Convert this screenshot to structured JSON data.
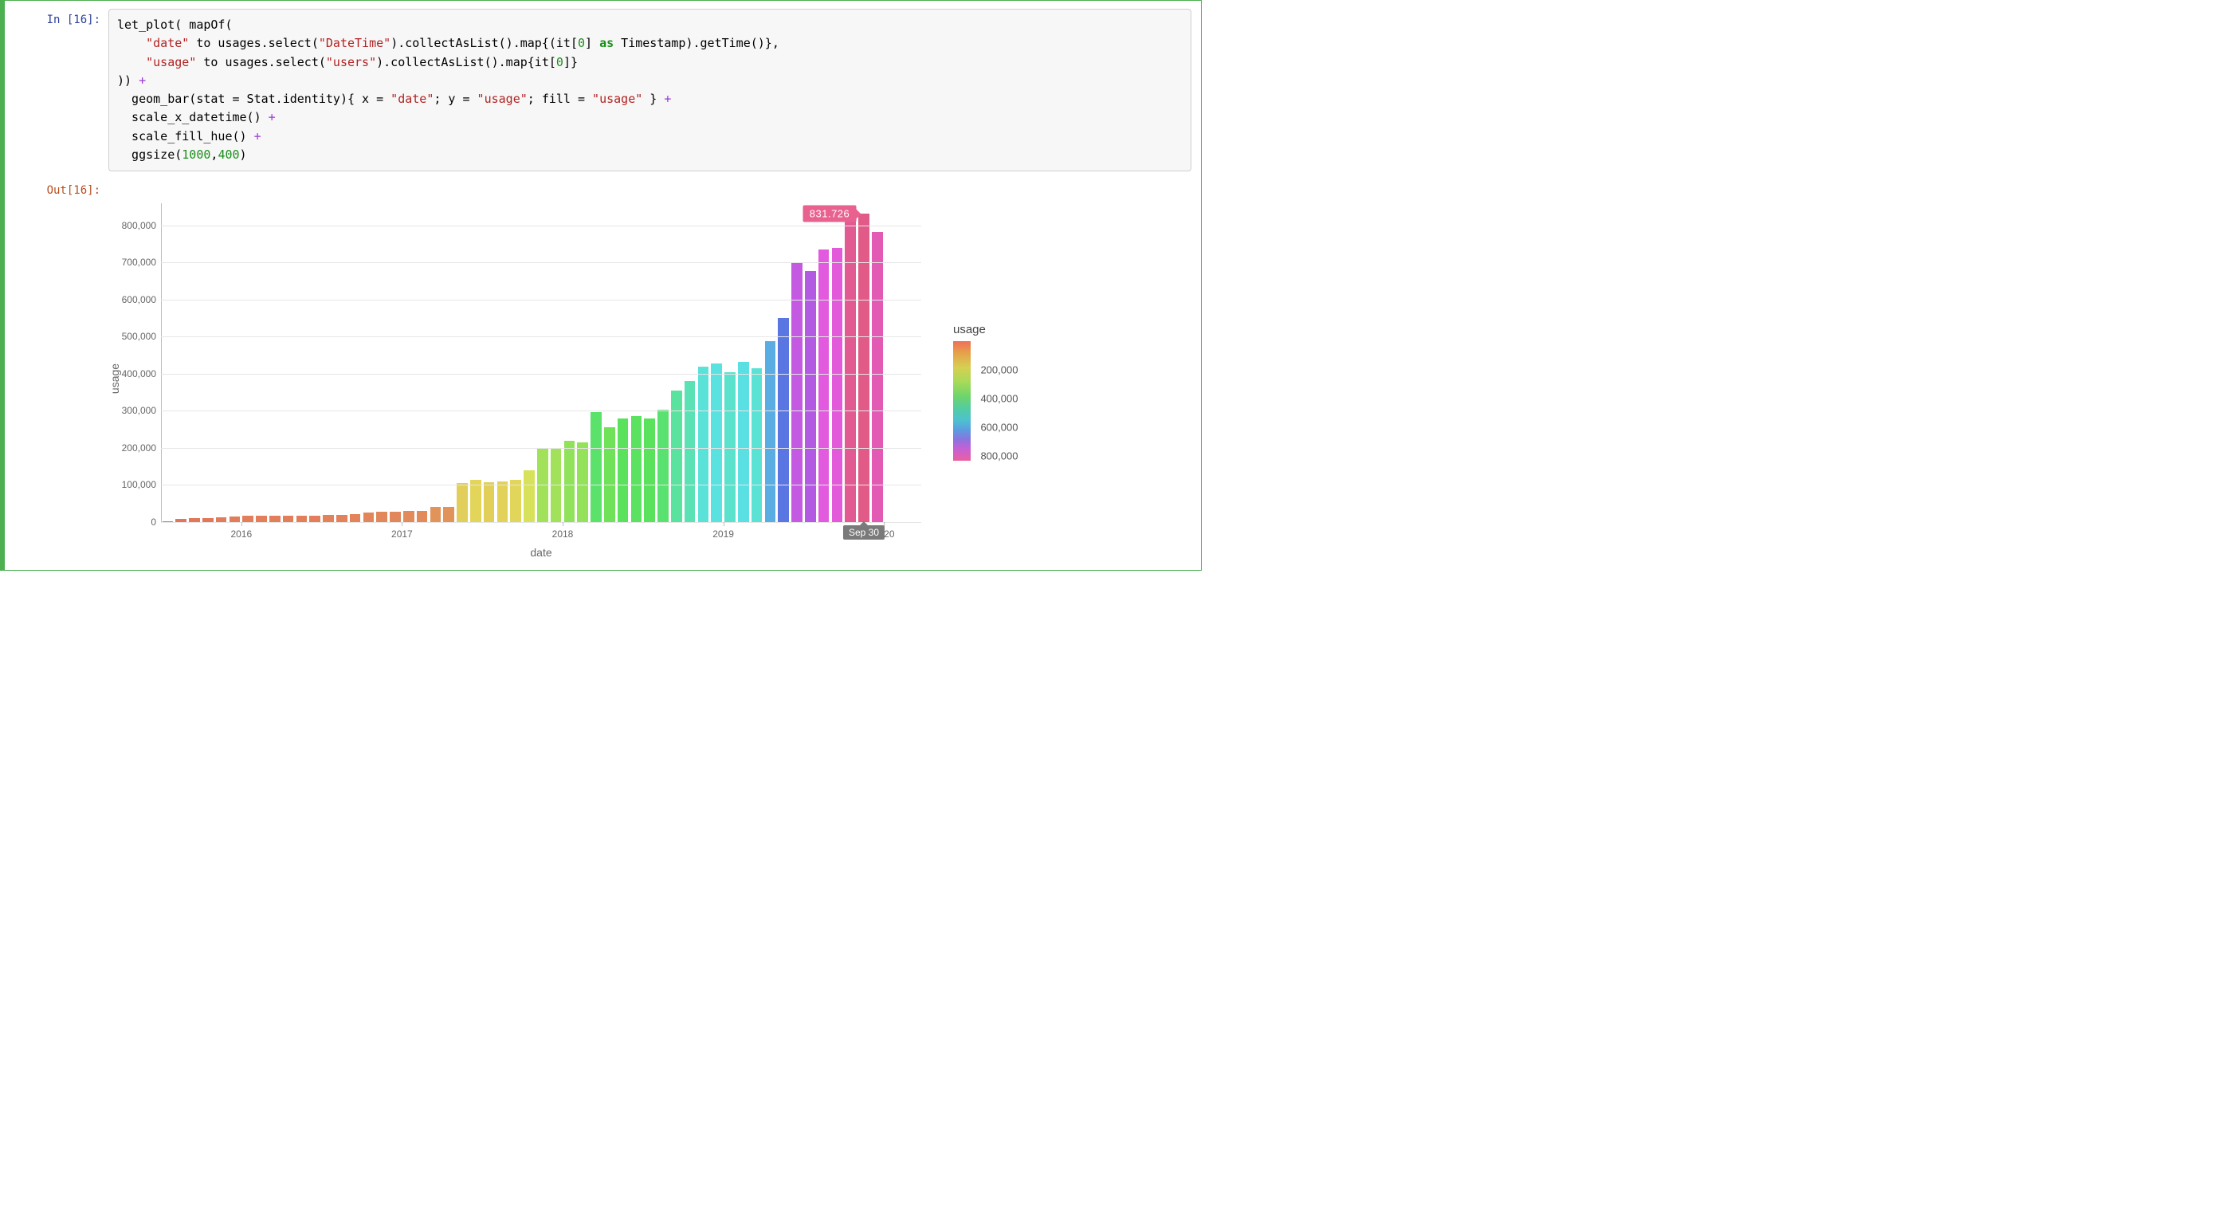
{
  "cell": {
    "in_label_prefix": "In [",
    "in_label_suffix": "]:",
    "out_label_prefix": "Out[",
    "out_label_suffix": "]:",
    "exec_count": "16"
  },
  "code": {
    "l1a": "let_plot( mapOf(",
    "l2a": "    ",
    "l2s1": "\"date\"",
    "l2b": " to usages.select(",
    "l2s2": "\"DateTime\"",
    "l2c": ").collectAsList().map{(it[",
    "l2n": "0",
    "l2d": "] ",
    "l2kw": "as",
    "l2e": " Timestamp).getTime()},",
    "l3a": "    ",
    "l3s1": "\"usage\"",
    "l3b": " to usages.select(",
    "l3s2": "\"users\"",
    "l3c": ").collectAsList().map{it[",
    "l3n": "0",
    "l3d": "]}",
    "l4a": ")) ",
    "l4op": "+",
    "l5a": "  geom_bar(stat = Stat.identity){ x = ",
    "l5s1": "\"date\"",
    "l5b": "; y = ",
    "l5s2": "\"usage\"",
    "l5c": "; fill = ",
    "l5s3": "\"usage\"",
    "l5d": " } ",
    "l5op": "+",
    "l6a": "  scale_x_datetime() ",
    "l6op": "+",
    "l7a": "  scale_fill_hue() ",
    "l7op": "+",
    "l8a": "  ggsize(",
    "l8n1": "1000",
    "l8b": ",",
    "l8n2": "400",
    "l8c": ")"
  },
  "chart_data": {
    "type": "bar",
    "xlabel": "date",
    "ylabel": "usage",
    "ylim": [
      0,
      860000
    ],
    "y_ticks": [
      0,
      100000,
      200000,
      300000,
      400000,
      500000,
      600000,
      700000,
      800000
    ],
    "y_tick_labels": [
      "0",
      "100,000",
      "200,000",
      "300,000",
      "400,000",
      "500,000",
      "600,000",
      "700,000",
      "800,000"
    ],
    "x_year_ticks": [
      {
        "label": "2016",
        "index": 6
      },
      {
        "label": "2017",
        "index": 18
      },
      {
        "label": "2018",
        "index": 30
      },
      {
        "label": "2019",
        "index": 42
      },
      {
        "label": "2020",
        "index": 54
      }
    ],
    "categories": [
      "2015-07",
      "2015-08",
      "2015-09",
      "2015-10",
      "2015-11",
      "2015-12",
      "2016-01",
      "2016-02",
      "2016-03",
      "2016-04",
      "2016-05",
      "2016-06",
      "2016-07",
      "2016-08",
      "2016-09",
      "2016-10",
      "2016-11",
      "2016-12",
      "2017-01",
      "2017-02",
      "2017-03",
      "2017-04",
      "2017-05",
      "2017-06",
      "2017-07",
      "2017-08",
      "2017-09",
      "2017-10",
      "2017-11",
      "2017-12",
      "2018-01",
      "2018-02",
      "2018-03",
      "2018-04",
      "2018-05",
      "2018-06",
      "2018-07",
      "2018-08",
      "2018-09",
      "2018-10",
      "2018-11",
      "2018-12",
      "2019-01",
      "2019-02",
      "2019-03",
      "2019-04",
      "2019-05",
      "2019-06",
      "2019-07",
      "2019-08",
      "2019-09",
      "2019-10",
      "2019-11"
    ],
    "values": [
      2000,
      8000,
      10000,
      10000,
      13000,
      15000,
      18000,
      18000,
      18000,
      18000,
      18000,
      18000,
      20000,
      20000,
      22000,
      25000,
      27000,
      27000,
      30000,
      30000,
      40000,
      40000,
      105000,
      113000,
      107000,
      110000,
      115000,
      140000,
      200000,
      200000,
      220000,
      215000,
      297000,
      255000,
      280000,
      285000,
      280000,
      303000,
      355000,
      380000,
      420000,
      428000,
      405000,
      432000,
      415000,
      488000,
      550000,
      698000,
      678000,
      735000,
      740000,
      820000,
      831726,
      782000
    ],
    "tooltip": {
      "value_label": "831.726",
      "index": 52
    },
    "x_hover": {
      "label": "Sep 30",
      "index": 52
    },
    "legend": {
      "title": "usage",
      "ticks": [
        200000,
        400000,
        600000,
        800000
      ],
      "tick_labels": [
        "200,000",
        "400,000",
        "600,000",
        "800,000"
      ]
    }
  }
}
